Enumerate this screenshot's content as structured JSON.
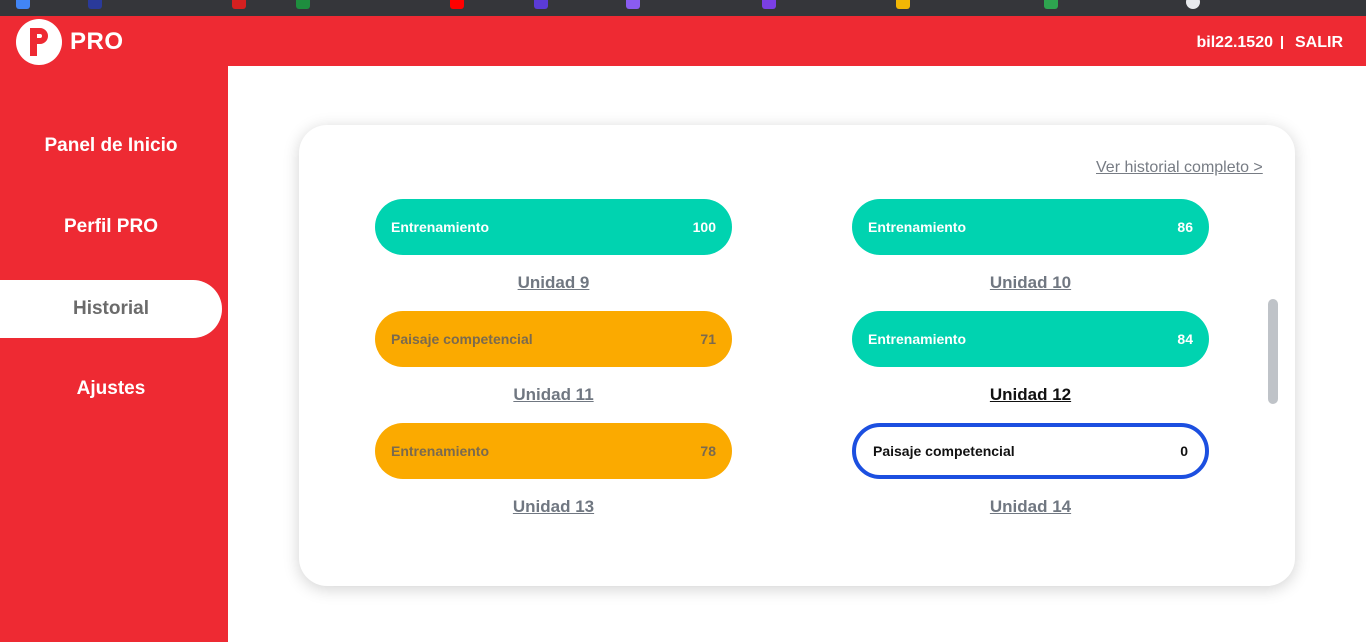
{
  "topbar": {
    "brand": "PRO",
    "username": "bil22.1520",
    "logout_label": "SALIR"
  },
  "sidebar": {
    "items": [
      {
        "label": "Panel de Inicio",
        "active": false
      },
      {
        "label": "Perfil PRO",
        "active": false
      },
      {
        "label": "Historial",
        "active": true
      },
      {
        "label": "Ajustes",
        "active": false
      }
    ]
  },
  "history": {
    "link_label": "Ver historial completo >",
    "entries": [
      {
        "activity": "Entrenamiento",
        "score": "100",
        "unit": "Unidad 9",
        "color": "#00d3b0"
      },
      {
        "activity": "Entrenamiento",
        "score": "86",
        "unit": "Unidad 10",
        "color": "#00d3b0"
      },
      {
        "activity": "Paisaje competencial",
        "score": "71",
        "unit": "Unidad 11",
        "color": "#fbaa00"
      },
      {
        "activity": "Entrenamiento",
        "score": "84",
        "unit": "Unidad 12",
        "color": "#00d3b0"
      },
      {
        "activity": "Entrenamiento",
        "score": "78",
        "unit": "Unidad 13",
        "color": "#fbaa00"
      },
      {
        "activity": "Paisaje competencial",
        "score": "0",
        "unit": "Unidad 14",
        "color": "#1c4fe0"
      }
    ]
  },
  "colors": {
    "brand_red": "#ee2a33",
    "green": "#00d3b0",
    "orange": "#fbaa00",
    "blue_outline": "#1c4fe0"
  }
}
